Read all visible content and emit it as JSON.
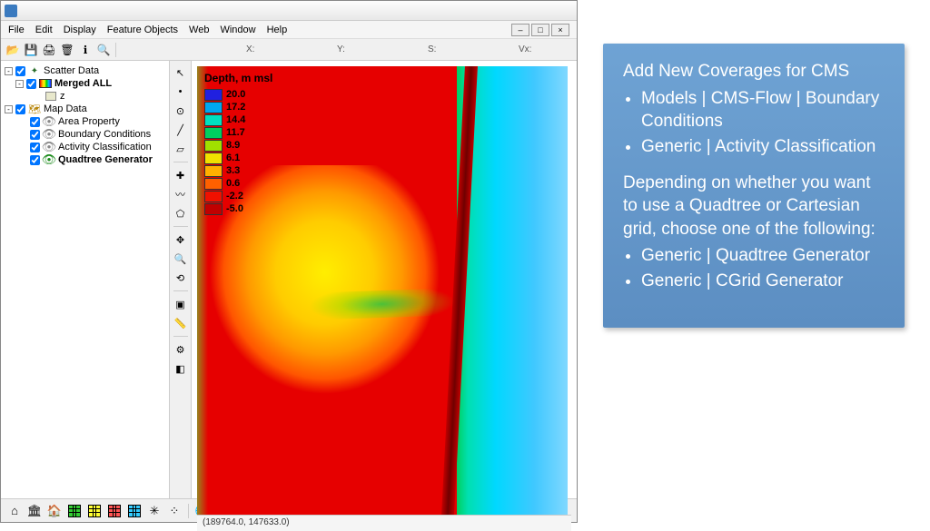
{
  "menu": {
    "file": "File",
    "edit": "Edit",
    "display": "Display",
    "feature": "Feature Objects",
    "web": "Web",
    "window": "Window",
    "help": "Help"
  },
  "coords": {
    "x": "X:",
    "y": "Y:",
    "s": "S:",
    "vx": "Vx:"
  },
  "tree": {
    "scatter": "Scatter Data",
    "merged": "Merged ALL",
    "z": "z",
    "map": "Map Data",
    "area": "Area Property",
    "bc": "Boundary Conditions",
    "activity": "Activity Classification",
    "quad": "Quadtree Generator"
  },
  "legend": {
    "title": "Depth, m msl",
    "rows": [
      {
        "v": "20.0",
        "c": "#2020e0"
      },
      {
        "v": "17.2",
        "c": "#00a8f0"
      },
      {
        "v": "14.4",
        "c": "#00e0c0"
      },
      {
        "v": "11.7",
        "c": "#00d060"
      },
      {
        "v": "8.9",
        "c": "#a0e000"
      },
      {
        "v": "6.1",
        "c": "#f0e000"
      },
      {
        "v": "3.3",
        "c": "#ffb000"
      },
      {
        "v": "0.6",
        "c": "#ff6000"
      },
      {
        "v": "-2.2",
        "c": "#f01000"
      },
      {
        "v": "-5.0",
        "c": "#c00000"
      }
    ]
  },
  "status": "(189764.0, 147633.0)",
  "info": {
    "heading": "Add New Coverages for CMS",
    "b1": "Models | CMS-Flow | Boundary Conditions",
    "b2": "Generic | Activity Classification",
    "para": "Depending on whether you want to use a Quadtree or Cartesian grid, choose one of the following:",
    "b3": "Generic | Quadtree Generator",
    "b4": "Generic | CGrid Generator"
  },
  "chart_data": {
    "type": "heatmap",
    "title": "Depth, m msl",
    "colorscale": [
      {
        "value": 20.0,
        "color": "#2020e0"
      },
      {
        "value": 17.2,
        "color": "#00a8f0"
      },
      {
        "value": 14.4,
        "color": "#00e0c0"
      },
      {
        "value": 11.7,
        "color": "#00d060"
      },
      {
        "value": 8.9,
        "color": "#a0e000"
      },
      {
        "value": 6.1,
        "color": "#f0e000"
      },
      {
        "value": 3.3,
        "color": "#ffb000"
      },
      {
        "value": 0.6,
        "color": "#ff6000"
      },
      {
        "value": -2.2,
        "color": "#f01000"
      },
      {
        "value": -5.0,
        "color": "#c00000"
      }
    ],
    "zlabel": "Depth (m msl)",
    "zlim": [
      -5.0,
      20.0
    ],
    "cursor_xy": [
      189764.0,
      147633.0
    ]
  }
}
